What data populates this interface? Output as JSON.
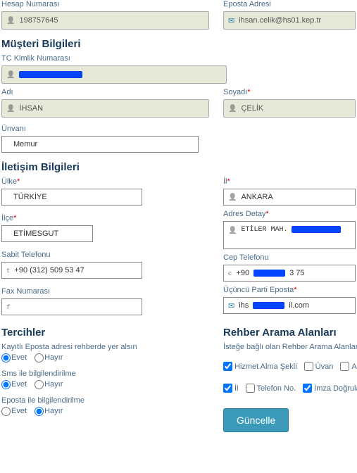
{
  "header": {
    "account_no_label": "Hesap Numarası",
    "account_no": "198757645",
    "email_label": "Eposta Adresi",
    "email": "ihsan.celik@hs01.kep.tr"
  },
  "sections": {
    "customer": "Müşteri Bilgileri",
    "contact": "İletişim Bilgileri",
    "prefs": "Tercihler",
    "search": "Rehber Arama Alanları"
  },
  "customer": {
    "tc_label": "TC Kimlik Numarası",
    "name_label": "Adı",
    "name": "İHSAN",
    "surname_label": "Soyadı",
    "surname": "ÇELİK",
    "title_label": "Ünvanı",
    "title": "Memur"
  },
  "contact": {
    "country_label": "Ülke",
    "country": "TÜRKİYE",
    "province_label": "İl",
    "province": "ANKARA",
    "district_label": "İlçe",
    "district": "ETİMESGUT",
    "address_label": "Adres Detay",
    "address_prefix": "ETİLER MAH.",
    "phone_label": "Sabit Telefonu",
    "phone": "+90 (312) 509 53 47",
    "cell_label": "Cep Telefonu",
    "cell_prefix": "+90",
    "cell_suffix": "3 75",
    "fax_label": "Fax Numarası",
    "third_email_label": "Üçüncü Parti Eposta",
    "third_email_prefix": "ihs",
    "third_email_suffix": "il.com"
  },
  "prefs": {
    "guide_label": "Kayıtlı Eposta adresi rehberde yer alsın",
    "sms_label": "Sms ile bilgilendirilme",
    "eposta_label": "Eposta ile bilgilendirilme",
    "yes": "Evet",
    "no": "Hayır"
  },
  "search": {
    "subtitle": "İsteğe bağlı olan Rehber Arama Alanları.",
    "opts": {
      "hizmet": "Hizmet Alma Şekli",
      "uvan": "Üvan",
      "adres": "Adre",
      "il": "İl",
      "telefon": "Telefon No.",
      "imza": "İmza Doğrulama"
    }
  },
  "actions": {
    "update": "Güncelle"
  },
  "req": "*"
}
